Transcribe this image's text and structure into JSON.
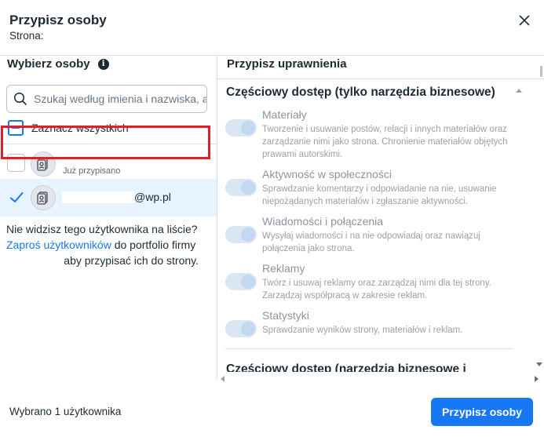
{
  "header": {
    "title": "Przypisz osoby",
    "subtitle": "Strona:"
  },
  "left": {
    "heading": "Wybierz osoby",
    "info_icon": "info-icon",
    "search": {
      "placeholder": "Szukaj według imienia i nazwiska, adresu e-mail",
      "value": ""
    },
    "select_all_label": "Zaznacz wszystkich",
    "users": [
      {
        "status": "Już przypisano",
        "checked": false
      },
      {
        "email": "@wp.pl",
        "checked": true
      }
    ],
    "notice": {
      "line1": "Nie widzisz tego użytkownika na liście?",
      "link": "Zaproś użytkowników",
      "line2_rest": " do portfolio firmy",
      "line3": "aby przypisać ich do strony."
    }
  },
  "right": {
    "heading": "Przypisz uprawnienia",
    "section1_title": "Częściowy dostęp (tylko narzędzia biznesowe)",
    "permissions": [
      {
        "title": "Materiały",
        "desc": "Tworzenie i usuwanie postów, relacji i innych materiałów oraz zarządzanie nimi jako strona. Chronienie materiałów objętych prawami autorskimi.",
        "enabled": true
      },
      {
        "title": "Aktywność w społeczności",
        "desc": "Sprawdzanie komentarzy i odpowiadanie na nie, usuwanie niepożądanych materiałów i zgłaszanie aktywności.",
        "enabled": true
      },
      {
        "title": "Wiadomości i połączenia",
        "desc": "Wysyłaj wiadomości i na nie odpowiadaj oraz nawiązuj połączenia jako strona.",
        "enabled": true
      },
      {
        "title": "Reklamy",
        "desc": "Twórz i usuwaj reklamy oraz zarządzaj nimi dla tej strony. Zarządzaj współpracą w zakresie reklam.",
        "enabled": true
      },
      {
        "title": "Statystyki",
        "desc": "Sprawdzanie wyników strony, materiałów i reklam.",
        "enabled": true
      }
    ],
    "section2_title": "Częściowy dostęp (narzędzia biznesowe i"
  },
  "footer": {
    "selected_count": "Wybrano 1 użytkownika",
    "assign_button": "Przypisz osoby"
  },
  "colors": {
    "primary": "#1877f2",
    "highlight": "#e01f28",
    "selected_row": "#e7f3ff"
  }
}
